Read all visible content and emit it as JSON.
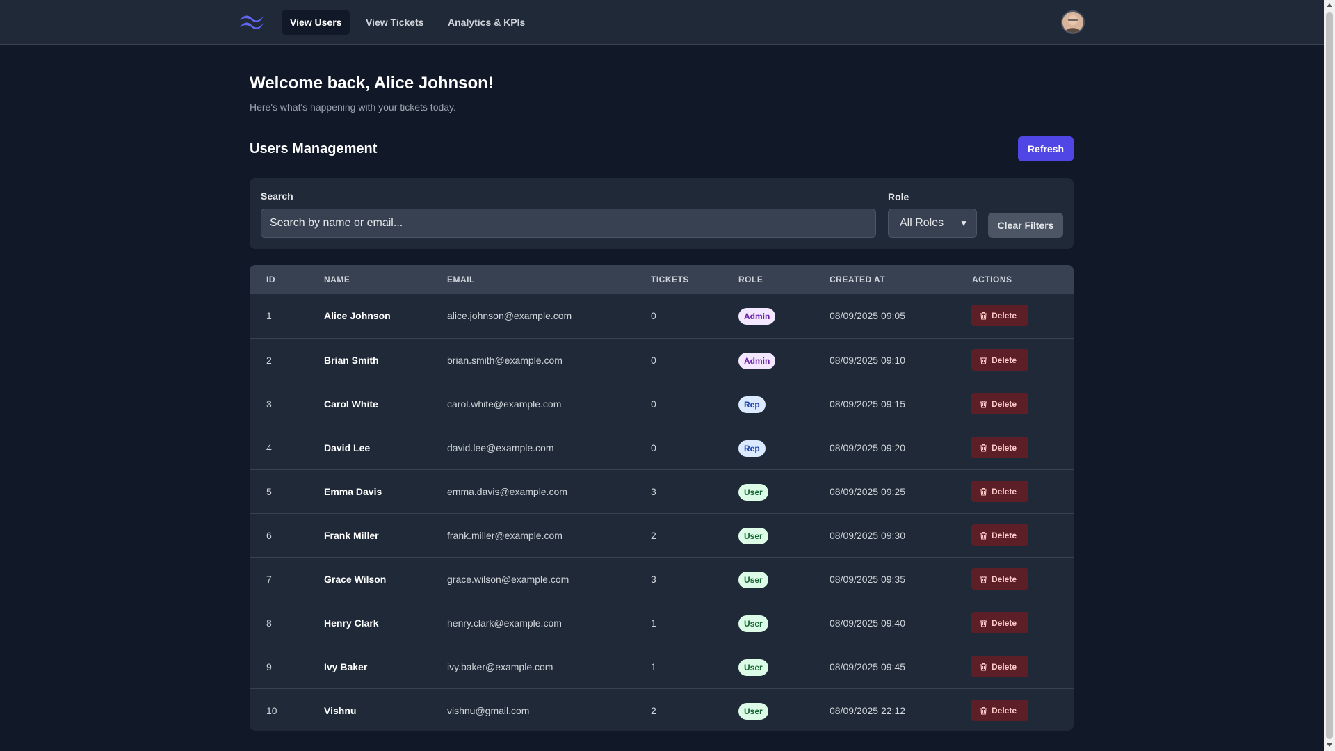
{
  "nav": {
    "links": [
      {
        "label": "View Users",
        "active": true
      },
      {
        "label": "View Tickets",
        "active": false
      },
      {
        "label": "Analytics & KPIs",
        "active": false
      }
    ]
  },
  "header": {
    "welcome": "Welcome back, Alice Johnson!",
    "subtitle": "Here's what's happening with your tickets today.",
    "section_title": "Users Management",
    "refresh_label": "Refresh"
  },
  "filters": {
    "search_label": "Search",
    "search_placeholder": "Search by name or email...",
    "role_label": "Role",
    "role_value": "All Roles",
    "clear_label": "Clear Filters"
  },
  "table": {
    "headers": [
      "ID",
      "NAME",
      "EMAIL",
      "TICKETS",
      "ROLE",
      "CREATED AT",
      "ACTIONS"
    ],
    "delete_label": "Delete",
    "rows": [
      {
        "id": "1",
        "name": "Alice Johnson",
        "email": "alice.johnson@example.com",
        "tickets": "0",
        "role": "Admin",
        "created": "08/09/2025 09:05"
      },
      {
        "id": "2",
        "name": "Brian Smith",
        "email": "brian.smith@example.com",
        "tickets": "0",
        "role": "Admin",
        "created": "08/09/2025 09:10"
      },
      {
        "id": "3",
        "name": "Carol White",
        "email": "carol.white@example.com",
        "tickets": "0",
        "role": "Rep",
        "created": "08/09/2025 09:15"
      },
      {
        "id": "4",
        "name": "David Lee",
        "email": "david.lee@example.com",
        "tickets": "0",
        "role": "Rep",
        "created": "08/09/2025 09:20"
      },
      {
        "id": "5",
        "name": "Emma Davis",
        "email": "emma.davis@example.com",
        "tickets": "3",
        "role": "User",
        "created": "08/09/2025 09:25"
      },
      {
        "id": "6",
        "name": "Frank Miller",
        "email": "frank.miller@example.com",
        "tickets": "2",
        "role": "User",
        "created": "08/09/2025 09:30"
      },
      {
        "id": "7",
        "name": "Grace Wilson",
        "email": "grace.wilson@example.com",
        "tickets": "3",
        "role": "User",
        "created": "08/09/2025 09:35"
      },
      {
        "id": "8",
        "name": "Henry Clark",
        "email": "henry.clark@example.com",
        "tickets": "1",
        "role": "User",
        "created": "08/09/2025 09:40"
      },
      {
        "id": "9",
        "name": "Ivy Baker",
        "email": "ivy.baker@example.com",
        "tickets": "1",
        "role": "User",
        "created": "08/09/2025 09:45"
      },
      {
        "id": "10",
        "name": "Vishnu",
        "email": "vishnu@gmail.com",
        "tickets": "2",
        "role": "User",
        "created": "08/09/2025 22:12"
      }
    ]
  },
  "colors": {
    "background": "#111827",
    "nav_bg": "#1f2937",
    "accent": "#4f46e5",
    "delete_bg": "#5c1f28"
  }
}
